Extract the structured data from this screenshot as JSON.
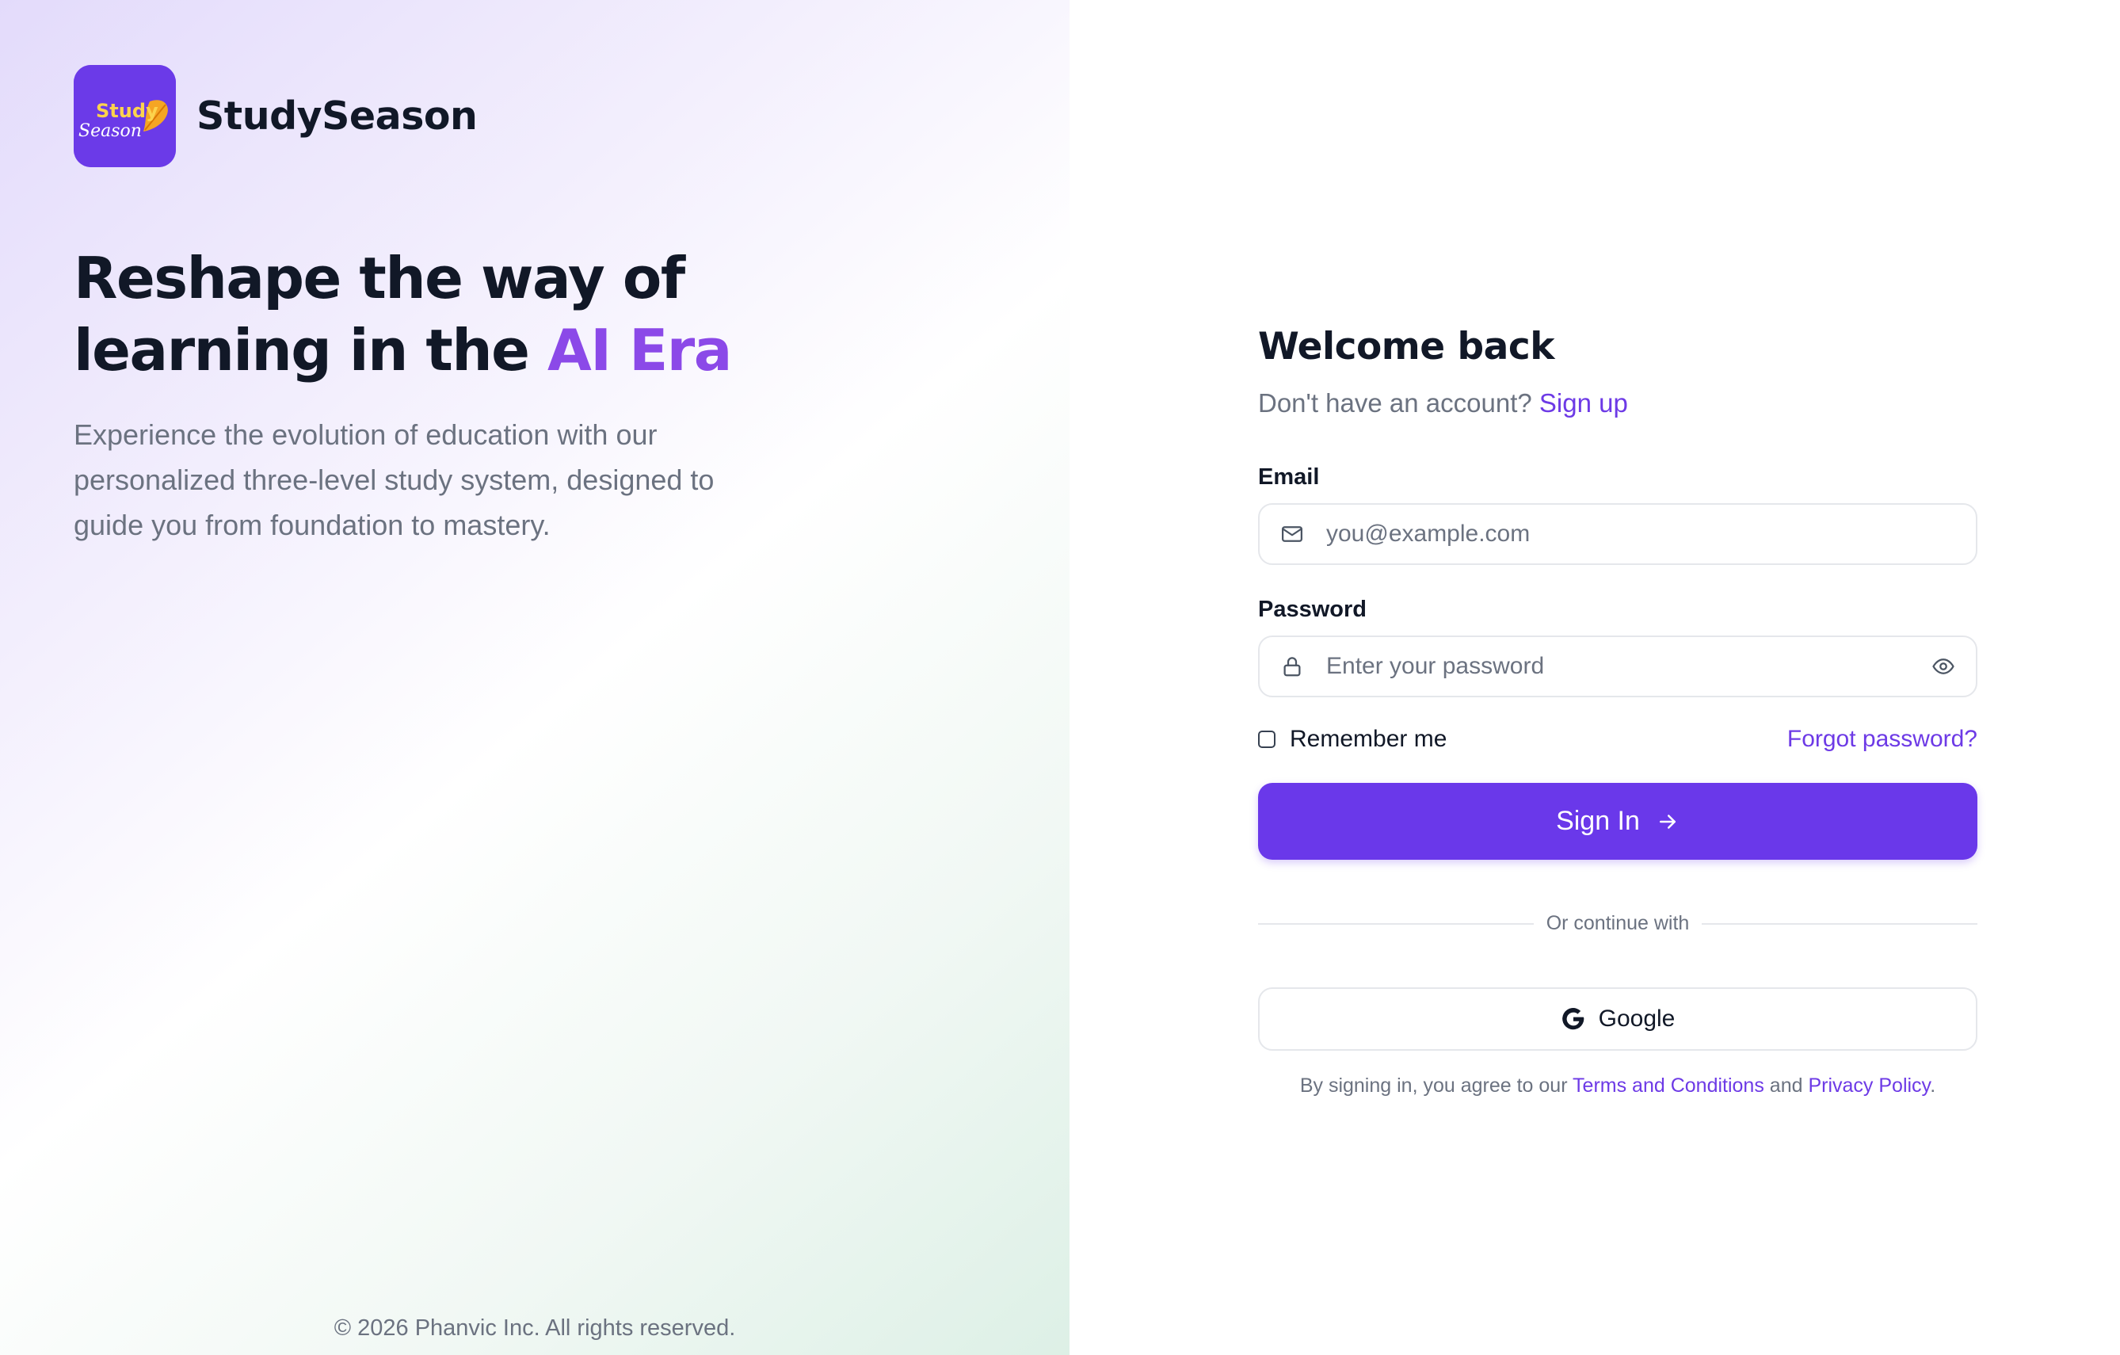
{
  "brand": {
    "logo_text_top": "Study",
    "logo_text_bottom": "Season",
    "name": "StudySeason",
    "color": "#6b3ae8"
  },
  "hero": {
    "headline_line1": "Reshape the way of",
    "headline_line2_prefix": "learning in the ",
    "headline_accent": "AI Era",
    "accent_color": "#8b49e8",
    "description": "Experience the evolution of education with our personalized three-level study system, designed to guide you from foundation to mastery."
  },
  "footer": {
    "copyright": "© 2026 Phanvic Inc. All rights reserved."
  },
  "form": {
    "title": "Welcome back",
    "no_account_text": "Don't have an account?",
    "signup_link": "Sign up",
    "email_label": "Email",
    "email_placeholder": "you@example.com",
    "email_icon": "mail-icon",
    "password_label": "Password",
    "password_placeholder": "Enter your password",
    "password_icon": "lock-icon",
    "toggle_visibility_icon": "eye-icon",
    "remember_label": "Remember me",
    "remember_checked": false,
    "forgot_link": "Forgot password?",
    "signin_label": "Sign In",
    "signin_icon": "arrow-right-icon",
    "primary_color": "#6a38ea",
    "divider_text": "Or continue with",
    "google_label": "Google",
    "google_icon": "google-icon",
    "terms_prefix": "By signing in, you agree to our",
    "terms_link": "Terms and Conditions",
    "terms_and": "and",
    "privacy_link": "Privacy Policy",
    "terms_suffix": "."
  }
}
